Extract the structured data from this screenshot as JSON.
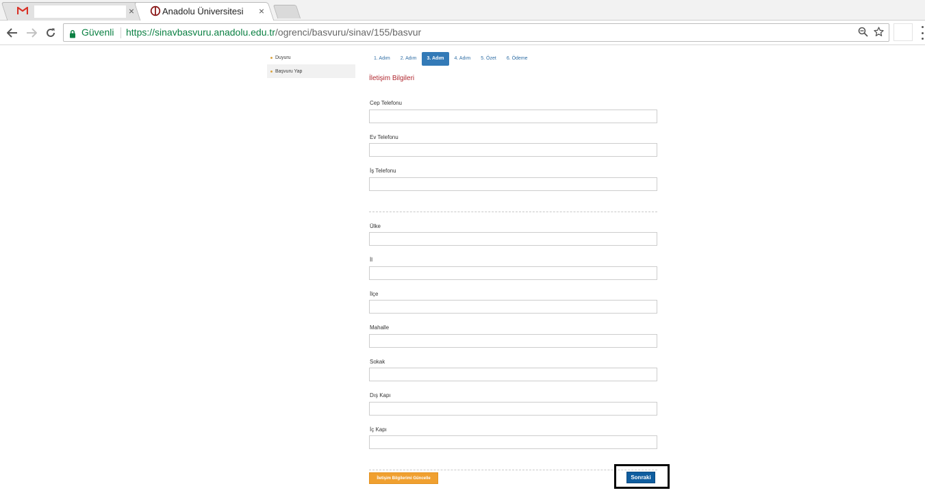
{
  "browser": {
    "tabs": [
      {
        "title": "",
        "icon": "gmail-icon",
        "active": false
      },
      {
        "title": "Anadolu Üniversitesi",
        "icon": "anadolu-logo-icon",
        "active": true
      }
    ],
    "close_glyph": "×",
    "secure_label": "Güvenli",
    "url_scheme": "https://",
    "url_host": "sinavbasvuru.anadolu.edu.tr",
    "url_path": "/ogrenci/basvuru/sinav/155/basvur"
  },
  "sidebar": {
    "items": [
      {
        "label": "Duyuru"
      },
      {
        "label": "Başvuru Yap"
      }
    ]
  },
  "steps": [
    {
      "label": "1. Adım",
      "active": false
    },
    {
      "label": "2. Adım",
      "active": false
    },
    {
      "label": "3. Adım",
      "active": true
    },
    {
      "label": "4. Adım",
      "active": false
    },
    {
      "label": "5. Özet",
      "active": false
    },
    {
      "label": "6. Ödeme",
      "active": false
    }
  ],
  "form": {
    "section_title": "İletişim Bilgileri",
    "phone_fields": [
      {
        "label": "Cep Telefonu",
        "value": ""
      },
      {
        "label": "Ev Telefonu",
        "value": ""
      },
      {
        "label": "İş Telefonu",
        "value": ""
      }
    ],
    "address_fields": [
      {
        "label": "Ülke",
        "value": ""
      },
      {
        "label": "İl",
        "value": ""
      },
      {
        "label": "İlçe",
        "value": ""
      },
      {
        "label": "Mahalle",
        "value": ""
      },
      {
        "label": "Sokak",
        "value": ""
      },
      {
        "label": "Dış Kapı",
        "value": ""
      },
      {
        "label": "İç Kapı",
        "value": ""
      }
    ],
    "update_button_label": "İletişim Bilgilerimi Güncelle",
    "next_button_label": "Sonraki"
  },
  "colors": {
    "accent_blue": "#337ab7",
    "section_title_red": "#b0272f",
    "update_button_orange": "#f0a030",
    "next_button_blue": "#0f5d9f",
    "secure_green": "#0b8043"
  }
}
